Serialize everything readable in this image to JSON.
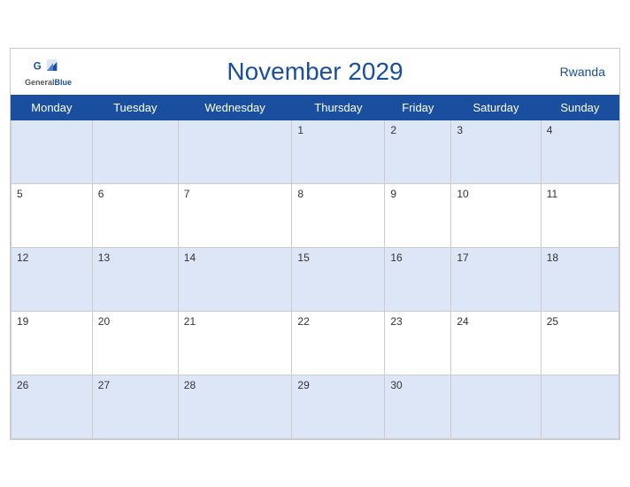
{
  "header": {
    "title": "November 2029",
    "country": "Rwanda",
    "logo_line1": "General",
    "logo_line2": "Blue"
  },
  "weekdays": [
    "Monday",
    "Tuesday",
    "Wednesday",
    "Thursday",
    "Friday",
    "Saturday",
    "Sunday"
  ],
  "weeks": [
    [
      null,
      null,
      null,
      1,
      2,
      3,
      4
    ],
    [
      5,
      6,
      7,
      8,
      9,
      10,
      11
    ],
    [
      12,
      13,
      14,
      15,
      16,
      17,
      18
    ],
    [
      19,
      20,
      21,
      22,
      23,
      24,
      25
    ],
    [
      26,
      27,
      28,
      29,
      30,
      null,
      null
    ]
  ]
}
